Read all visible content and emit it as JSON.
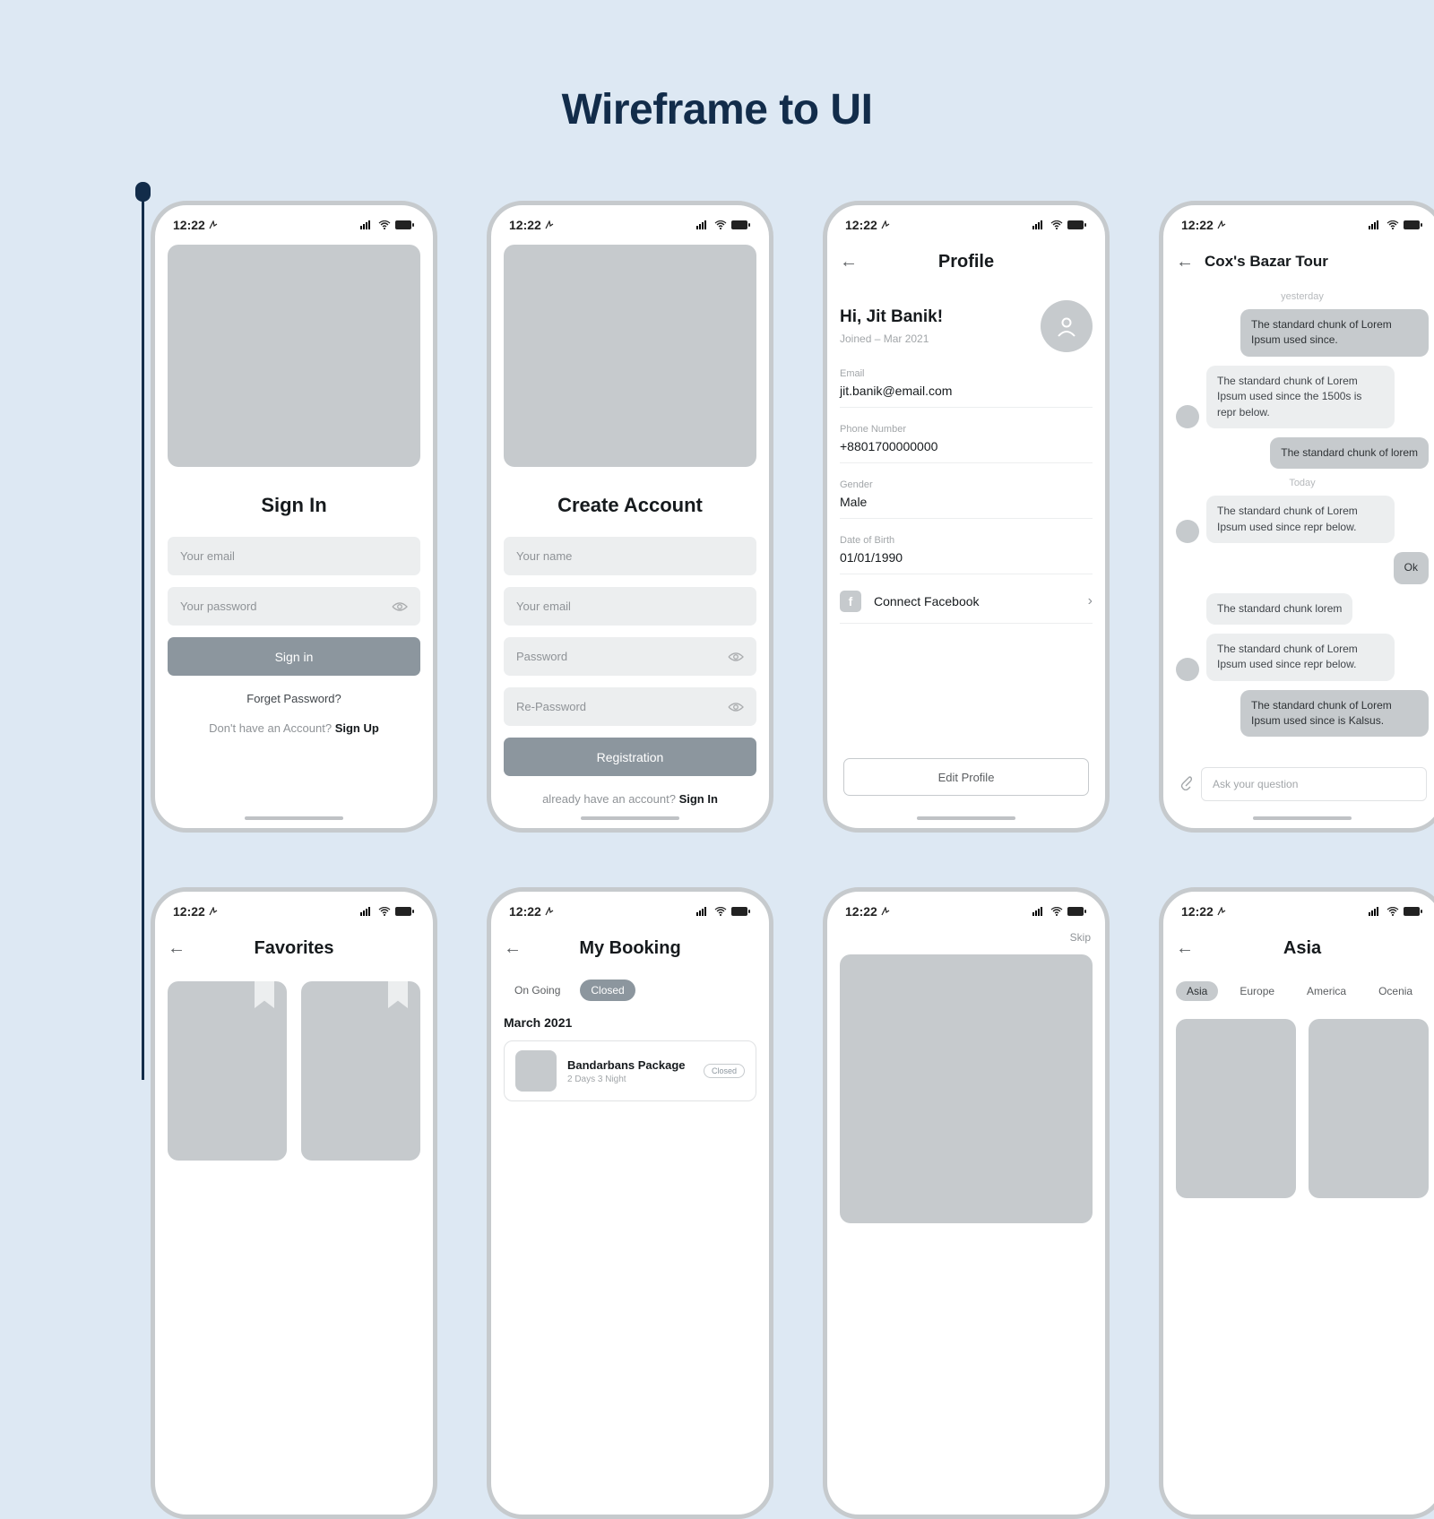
{
  "page_title": "Wireframe to UI",
  "status": {
    "time": "12:22"
  },
  "signin": {
    "title": "Sign In",
    "email_ph": "Your email",
    "password_ph": "Your password",
    "button": "Sign in",
    "forgot": "Forget Password?",
    "noacct_prefix": "Don't have an Account?  ",
    "noacct_link": "Sign Up"
  },
  "signup": {
    "title": "Create Account",
    "name_ph": "Your name",
    "email_ph": "Your email",
    "password_ph": "Password",
    "repassword_ph": "Re-Password",
    "button": "Registration",
    "have_prefix": "already have an account? ",
    "have_link": "Sign In"
  },
  "profile": {
    "header": "Profile",
    "greeting": "Hi, Jit Banik!",
    "joined": "Joined  –  Mar 2021",
    "rows": [
      {
        "label": "Email",
        "value": "jit.banik@email.com"
      },
      {
        "label": "Phone Number",
        "value": "+8801700000000"
      },
      {
        "label": "Gender",
        "value": "Male"
      },
      {
        "label": "Date of Birth",
        "value": "01/01/1990"
      }
    ],
    "connect_fb": "Connect Facebook",
    "edit": "Edit Profile"
  },
  "chat": {
    "header": "Cox's Bazar Tour",
    "day1": "yesterday",
    "day2": "Today",
    "m1": "The standard chunk of Lorem Ipsum used since.",
    "m2": "The standard chunk of Lorem Ipsum used since the 1500s is repr below.",
    "m3": "The standard chunk of lorem",
    "m4": "The standard chunk of Lorem Ipsum used since repr below.",
    "m5": "Ok",
    "m6": "The standard chunk lorem",
    "m7": "The standard chunk of Lorem Ipsum used since repr below.",
    "m8": "The standard chunk of Lorem Ipsum used since is Kalsus.",
    "input_ph": "Ask your question"
  },
  "favorites": {
    "header": "Favorites"
  },
  "booking": {
    "header": "My Booking",
    "tab1": "On Going",
    "tab2": "Closed",
    "month": "March 2021",
    "card_title": "Bandarbans Package",
    "card_sub": "2 Days 3 Night",
    "card_status": "Closed"
  },
  "onboard": {
    "skip": "Skip"
  },
  "region": {
    "header": "Asia",
    "chips": [
      "Asia",
      "Europe",
      "America",
      "Ocenia"
    ]
  }
}
